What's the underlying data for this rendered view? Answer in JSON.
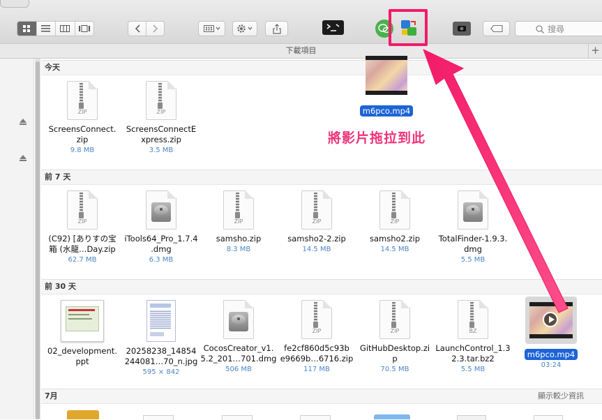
{
  "window": {
    "title": "下載項目"
  },
  "toolbar": {
    "view_modes": [
      "icon-view",
      "list-view",
      "column-view",
      "cover-flow-view"
    ],
    "active_view": 0,
    "nav": [
      "back",
      "forward"
    ],
    "arrange_icon": "arrange-icon",
    "action_icon": "gear-icon",
    "share_icon": "share-icon",
    "extensions": [
      "terminal-app-icon",
      "wechat-app-icon",
      "drop-target-app-icon",
      "screenshot-app-icon",
      "tag-icon"
    ],
    "search_placeholder": "搜尋"
  },
  "annotation": {
    "text": "將影片拖拉到此",
    "dragged_file": "m6pco.mp4",
    "color": "#f21b67"
  },
  "sections": [
    {
      "title": "今天",
      "items": [
        {
          "name1": "ScreensConnect.",
          "name2": "zip",
          "meta": "9.8 MB",
          "kind": "ZIP"
        },
        {
          "name1": "ScreensConnectE",
          "name2": "xpress.zip",
          "meta": "3.5 MB",
          "kind": "ZIP"
        }
      ]
    },
    {
      "title": "前 7 天",
      "items": [
        {
          "name1": "(C92) [ありすの宝",
          "name2": "箱 (水龍…Day.zip",
          "meta": "62.7 MB",
          "kind": "ZIP"
        },
        {
          "name1": "iTools64_Pro_1.7.4",
          "name2": ".dmg",
          "meta": "6.3 MB",
          "kind": "DMG"
        },
        {
          "name1": "samsho.zip",
          "name2": "",
          "meta": "8.3 MB",
          "kind": "ZIP"
        },
        {
          "name1": "samsho2-2.zip",
          "name2": "",
          "meta": "14.5 MB",
          "kind": "ZIP"
        },
        {
          "name1": "samsho2.zip",
          "name2": "",
          "meta": "14.5 MB",
          "kind": "ZIP"
        },
        {
          "name1": "TotalFinder-1.9.3.",
          "name2": "dmg",
          "meta": "5.5 MB",
          "kind": "DMG"
        }
      ]
    },
    {
      "title": "前 30 天",
      "items": [
        {
          "name1": "02_development.",
          "name2": "ppt",
          "meta": "",
          "kind": "PPT"
        },
        {
          "name1": "20258238_14854",
          "name2": "244081…70_n.jpg",
          "meta": "595 × 842",
          "kind": "JPG"
        },
        {
          "name1": "CocosCreator_v1.",
          "name2": "5.2_201…701.dmg",
          "meta": "506 MB",
          "kind": "DMG"
        },
        {
          "name1": "fe2cf860d5c93b",
          "name2": "e9669b…6716.zip",
          "meta": "117 MB",
          "kind": "ZIP"
        },
        {
          "name1": "GitHubDesktop.zi",
          "name2": "p",
          "meta": "70.5 MB",
          "kind": "ZIP"
        },
        {
          "name1": "LaunchControl_1.3",
          "name2": "2.3.tar.bz2",
          "meta": "5.5 MB",
          "kind": "BZ"
        },
        {
          "name1": "m6pco.mp4",
          "name2": "",
          "meta": "03:24",
          "kind": "MP4"
        }
      ]
    },
    {
      "title": "7月",
      "show_less": "顯示較少資訊",
      "items": []
    }
  ]
}
